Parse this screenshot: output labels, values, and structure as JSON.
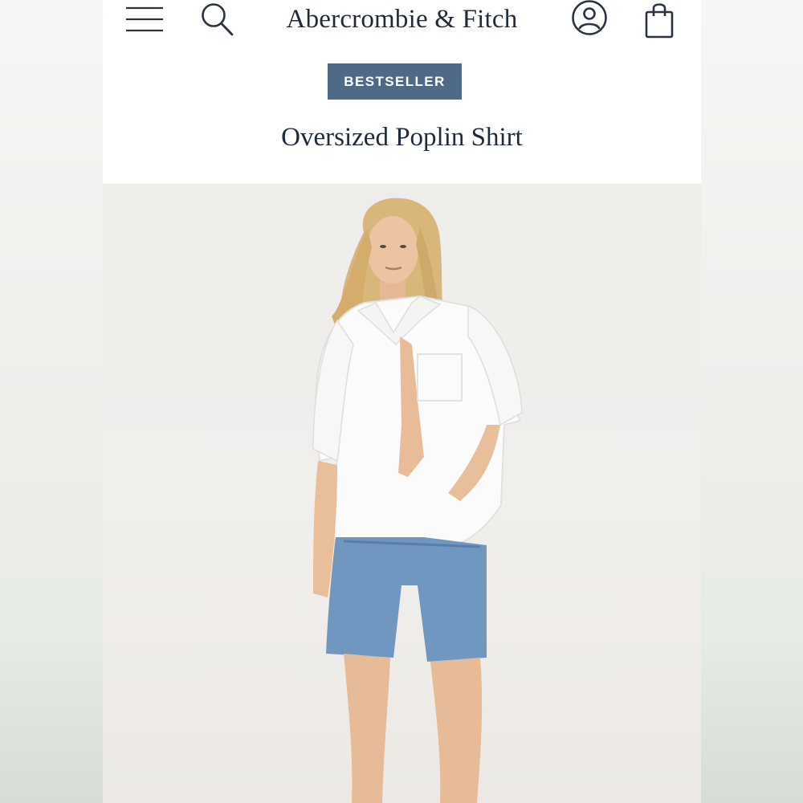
{
  "brand": {
    "logo_text": "Abercrombie & Fitch"
  },
  "header": {
    "menu_icon": "menu-icon",
    "search_icon": "search-icon",
    "account_icon": "account-icon",
    "bag_icon": "shopping-bag-icon"
  },
  "product": {
    "badge": "BESTSELLER",
    "name": "Oversized Poplin Shirt",
    "image_description": "Model wearing white oversized poplin shirt with denim bermuda shorts",
    "colors": {
      "badge_bg": "#4e6a86",
      "title_text": "#1f2b3a",
      "shirt": "#ffffff",
      "denim": "#6f97bf"
    }
  }
}
